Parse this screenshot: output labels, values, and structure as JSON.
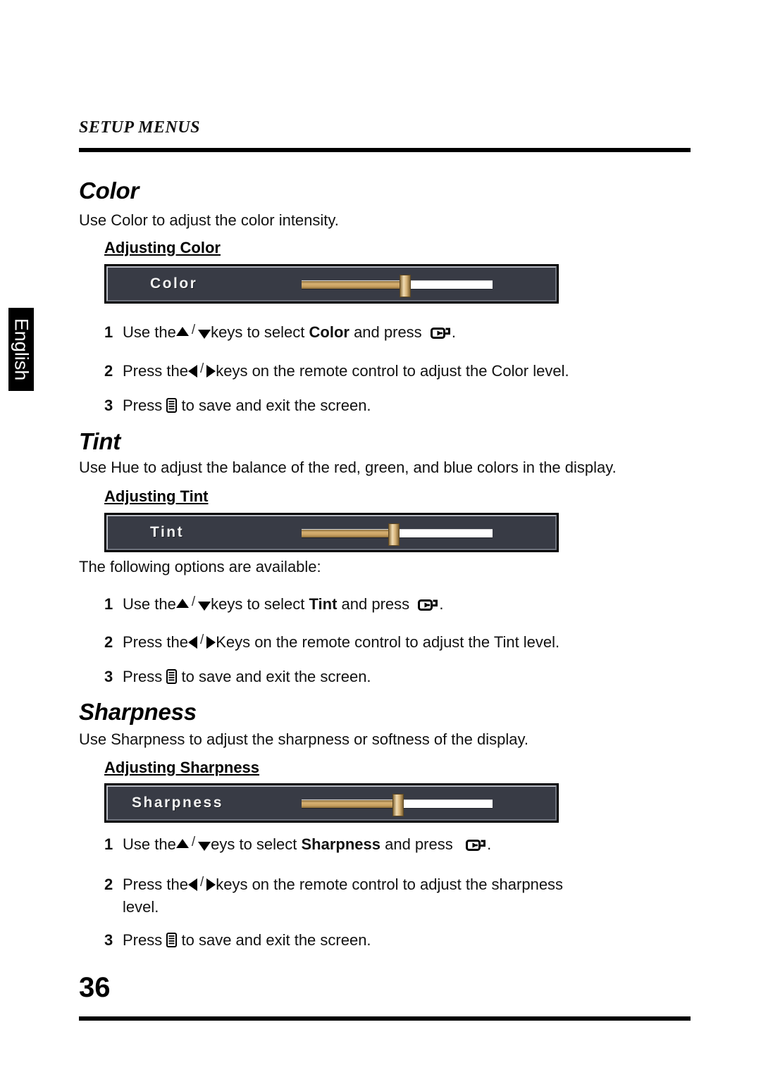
{
  "language_tab": {
    "label": "English"
  },
  "header": {
    "running_head": "SETUP MENUS"
  },
  "footer": {
    "page_number": "36"
  },
  "icons": {
    "enter_key": "enter-key-icon",
    "menu_key": "menu-key-icon",
    "arrow_up": "arrow-up-icon",
    "arrow_down": "arrow-down-icon",
    "arrow_left": "arrow-left-icon",
    "arrow_right": "arrow-right-icon"
  },
  "colors": {
    "osd_body": "#383b45",
    "osd_border_light": "#b9bcc4",
    "osd_border_dark": "#6e727c",
    "slider_fill": "#c79f5f",
    "slider_track": "#ffffff",
    "slider_thumb": "#d6b277",
    "rule": "#000000",
    "tab_background": "#000000",
    "tab_text": "#ffffff"
  },
  "sections": [
    {
      "title": "Color",
      "intro": "Use Color to adjust the color intensity.",
      "subhead": "Adjusting Color",
      "osd": {
        "label": "Color",
        "fill_percent": 54
      },
      "steps": [
        {
          "num": "1",
          "pre": "Use the",
          "mid": "keys to select ",
          "keyword": "Color",
          "post": " and press",
          "tail": "."
        },
        {
          "num": "2",
          "pre": "Press the",
          "mid": "keys on the remote control to adjust the Color level."
        },
        {
          "num": "3",
          "pre": "Press",
          "mid": "to save and exit the screen."
        }
      ]
    },
    {
      "title": "Tint",
      "intro": "Use Hue to adjust the balance of the red, green, and blue colors in the display.",
      "subhead": "Adjusting Tint",
      "options_note": "The following options are available:",
      "osd": {
        "label": "Tint",
        "fill_percent": 48
      },
      "steps": [
        {
          "num": "1",
          "pre": "Use the",
          "mid": "keys to select ",
          "keyword": "Tint",
          "post": " and press",
          "tail": "."
        },
        {
          "num": "2",
          "pre": "Press the",
          "mid": "Keys on the remote control to adjust the Tint level."
        },
        {
          "num": "3",
          "pre": "Press",
          "mid": "to save and exit the screen."
        }
      ]
    },
    {
      "title": "Sharpness",
      "intro": "Use Sharpness to adjust the sharpness or softness of the display.",
      "subhead": "Adjusting Sharpness",
      "osd": {
        "label": "Sharpness",
        "fill_percent": 50
      },
      "steps": [
        {
          "num": "1",
          "pre": "Use the",
          "mid": "eys to select ",
          "keyword": "Sharpness",
          "post": " and press",
          "tail": "."
        },
        {
          "num": "2",
          "pre": "Press the",
          "mid": "keys on the remote control to adjust the sharpness",
          "cont": "level."
        },
        {
          "num": "3",
          "pre": "Press",
          "mid": "to save and exit the screen."
        }
      ]
    }
  ]
}
